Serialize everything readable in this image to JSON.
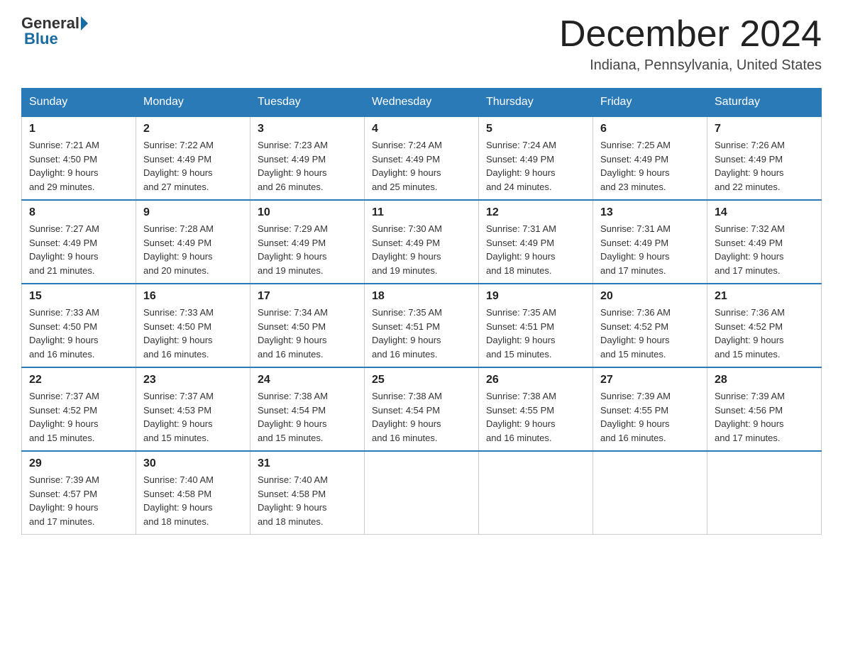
{
  "logo": {
    "general": "General",
    "blue": "Blue"
  },
  "title": "December 2024",
  "subtitle": "Indiana, Pennsylvania, United States",
  "days_of_week": [
    "Sunday",
    "Monday",
    "Tuesday",
    "Wednesday",
    "Thursday",
    "Friday",
    "Saturday"
  ],
  "weeks": [
    [
      {
        "day": "1",
        "sunrise": "7:21 AM",
        "sunset": "4:50 PM",
        "daylight": "9 hours and 29 minutes."
      },
      {
        "day": "2",
        "sunrise": "7:22 AM",
        "sunset": "4:49 PM",
        "daylight": "9 hours and 27 minutes."
      },
      {
        "day": "3",
        "sunrise": "7:23 AM",
        "sunset": "4:49 PM",
        "daylight": "9 hours and 26 minutes."
      },
      {
        "day": "4",
        "sunrise": "7:24 AM",
        "sunset": "4:49 PM",
        "daylight": "9 hours and 25 minutes."
      },
      {
        "day": "5",
        "sunrise": "7:24 AM",
        "sunset": "4:49 PM",
        "daylight": "9 hours and 24 minutes."
      },
      {
        "day": "6",
        "sunrise": "7:25 AM",
        "sunset": "4:49 PM",
        "daylight": "9 hours and 23 minutes."
      },
      {
        "day": "7",
        "sunrise": "7:26 AM",
        "sunset": "4:49 PM",
        "daylight": "9 hours and 22 minutes."
      }
    ],
    [
      {
        "day": "8",
        "sunrise": "7:27 AM",
        "sunset": "4:49 PM",
        "daylight": "9 hours and 21 minutes."
      },
      {
        "day": "9",
        "sunrise": "7:28 AM",
        "sunset": "4:49 PM",
        "daylight": "9 hours and 20 minutes."
      },
      {
        "day": "10",
        "sunrise": "7:29 AM",
        "sunset": "4:49 PM",
        "daylight": "9 hours and 19 minutes."
      },
      {
        "day": "11",
        "sunrise": "7:30 AM",
        "sunset": "4:49 PM",
        "daylight": "9 hours and 19 minutes."
      },
      {
        "day": "12",
        "sunrise": "7:31 AM",
        "sunset": "4:49 PM",
        "daylight": "9 hours and 18 minutes."
      },
      {
        "day": "13",
        "sunrise": "7:31 AM",
        "sunset": "4:49 PM",
        "daylight": "9 hours and 17 minutes."
      },
      {
        "day": "14",
        "sunrise": "7:32 AM",
        "sunset": "4:49 PM",
        "daylight": "9 hours and 17 minutes."
      }
    ],
    [
      {
        "day": "15",
        "sunrise": "7:33 AM",
        "sunset": "4:50 PM",
        "daylight": "9 hours and 16 minutes."
      },
      {
        "day": "16",
        "sunrise": "7:33 AM",
        "sunset": "4:50 PM",
        "daylight": "9 hours and 16 minutes."
      },
      {
        "day": "17",
        "sunrise": "7:34 AM",
        "sunset": "4:50 PM",
        "daylight": "9 hours and 16 minutes."
      },
      {
        "day": "18",
        "sunrise": "7:35 AM",
        "sunset": "4:51 PM",
        "daylight": "9 hours and 16 minutes."
      },
      {
        "day": "19",
        "sunrise": "7:35 AM",
        "sunset": "4:51 PM",
        "daylight": "9 hours and 15 minutes."
      },
      {
        "day": "20",
        "sunrise": "7:36 AM",
        "sunset": "4:52 PM",
        "daylight": "9 hours and 15 minutes."
      },
      {
        "day": "21",
        "sunrise": "7:36 AM",
        "sunset": "4:52 PM",
        "daylight": "9 hours and 15 minutes."
      }
    ],
    [
      {
        "day": "22",
        "sunrise": "7:37 AM",
        "sunset": "4:52 PM",
        "daylight": "9 hours and 15 minutes."
      },
      {
        "day": "23",
        "sunrise": "7:37 AM",
        "sunset": "4:53 PM",
        "daylight": "9 hours and 15 minutes."
      },
      {
        "day": "24",
        "sunrise": "7:38 AM",
        "sunset": "4:54 PM",
        "daylight": "9 hours and 15 minutes."
      },
      {
        "day": "25",
        "sunrise": "7:38 AM",
        "sunset": "4:54 PM",
        "daylight": "9 hours and 16 minutes."
      },
      {
        "day": "26",
        "sunrise": "7:38 AM",
        "sunset": "4:55 PM",
        "daylight": "9 hours and 16 minutes."
      },
      {
        "day": "27",
        "sunrise": "7:39 AM",
        "sunset": "4:55 PM",
        "daylight": "9 hours and 16 minutes."
      },
      {
        "day": "28",
        "sunrise": "7:39 AM",
        "sunset": "4:56 PM",
        "daylight": "9 hours and 17 minutes."
      }
    ],
    [
      {
        "day": "29",
        "sunrise": "7:39 AM",
        "sunset": "4:57 PM",
        "daylight": "9 hours and 17 minutes."
      },
      {
        "day": "30",
        "sunrise": "7:40 AM",
        "sunset": "4:58 PM",
        "daylight": "9 hours and 18 minutes."
      },
      {
        "day": "31",
        "sunrise": "7:40 AM",
        "sunset": "4:58 PM",
        "daylight": "9 hours and 18 minutes."
      },
      null,
      null,
      null,
      null
    ]
  ],
  "labels": {
    "sunrise": "Sunrise:",
    "sunset": "Sunset:",
    "daylight": "Daylight:"
  }
}
